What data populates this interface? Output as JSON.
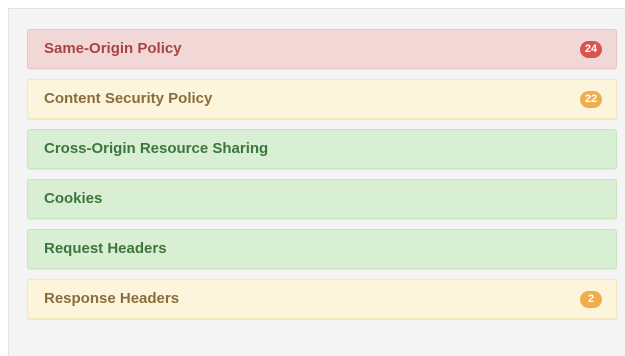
{
  "items": [
    {
      "label": "Same-Origin Policy",
      "status": "danger",
      "count": "24"
    },
    {
      "label": "Content Security Policy",
      "status": "warning",
      "count": "22"
    },
    {
      "label": "Cross-Origin Resource Sharing",
      "status": "success",
      "count": null
    },
    {
      "label": "Cookies",
      "status": "success",
      "count": null
    },
    {
      "label": "Request Headers",
      "status": "success",
      "count": null
    },
    {
      "label": "Response Headers",
      "status": "warning",
      "count": "2"
    }
  ],
  "colors": {
    "danger_bg": "#f2d7d7",
    "danger_text": "#a94442",
    "danger_badge": "#d9534f",
    "warning_bg": "#fcf5dc",
    "warning_text": "#8a6d3b",
    "warning_badge": "#f0ad4e",
    "success_bg": "#d9efd3",
    "success_text": "#3c763d"
  }
}
